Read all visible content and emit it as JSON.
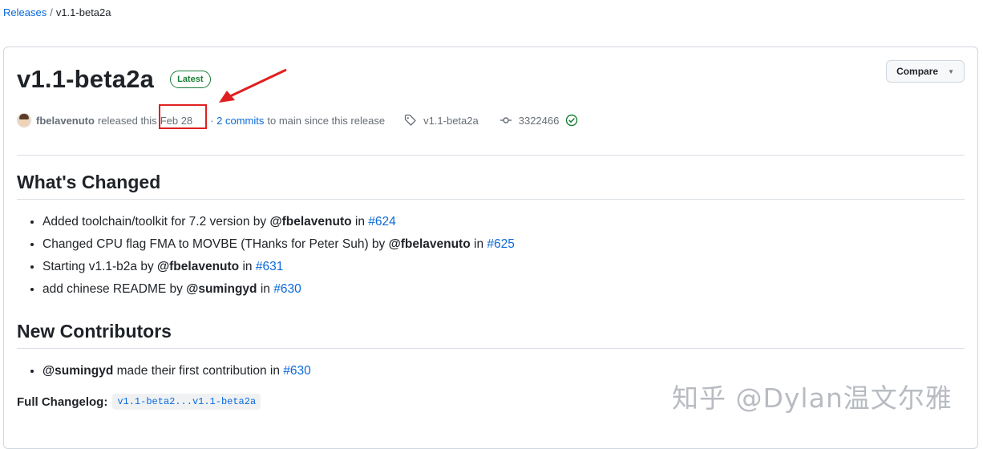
{
  "breadcrumb": {
    "root": "Releases",
    "separator": "/",
    "current": "v1.1-beta2a"
  },
  "release": {
    "title": "v1.1-beta2a",
    "badge": "Latest",
    "compare_label": "Compare",
    "author": "fbelavenuto",
    "released_text": "released this",
    "date": "Feb 28",
    "commits_prefix": "·",
    "commits_link": "2 commits",
    "commits_suffix": "to main since this release",
    "tag": "v1.1-beta2a",
    "commit_sha": "3322466"
  },
  "whats_changed": {
    "heading": "What's Changed",
    "items": [
      {
        "text": "Added toolchain/toolkit for 7.2 version by ",
        "user": "@fbelavenuto",
        "in": " in ",
        "pr": "#624"
      },
      {
        "text": "Changed CPU flag FMA to MOVBE (THanks for Peter Suh) by ",
        "user": "@fbelavenuto",
        "in": " in ",
        "pr": "#625"
      },
      {
        "text": "Starting v1.1-b2a by ",
        "user": "@fbelavenuto",
        "in": " in ",
        "pr": "#631"
      },
      {
        "text": "add chinese README by ",
        "user": "@sumingyd",
        "in": " in ",
        "pr": "#630"
      }
    ]
  },
  "new_contributors": {
    "heading": "New Contributors",
    "items": [
      {
        "user": "@sumingyd",
        "text": " made their first contribution in ",
        "pr": "#630"
      }
    ]
  },
  "changelog": {
    "label": "Full Changelog:",
    "link": "v1.1-beta2...v1.1-beta2a"
  },
  "watermark": "知乎 @Dylan温文尔雅",
  "colors": {
    "link": "#0969da",
    "latest": "#1a7f37",
    "annotation": "#e02020"
  }
}
